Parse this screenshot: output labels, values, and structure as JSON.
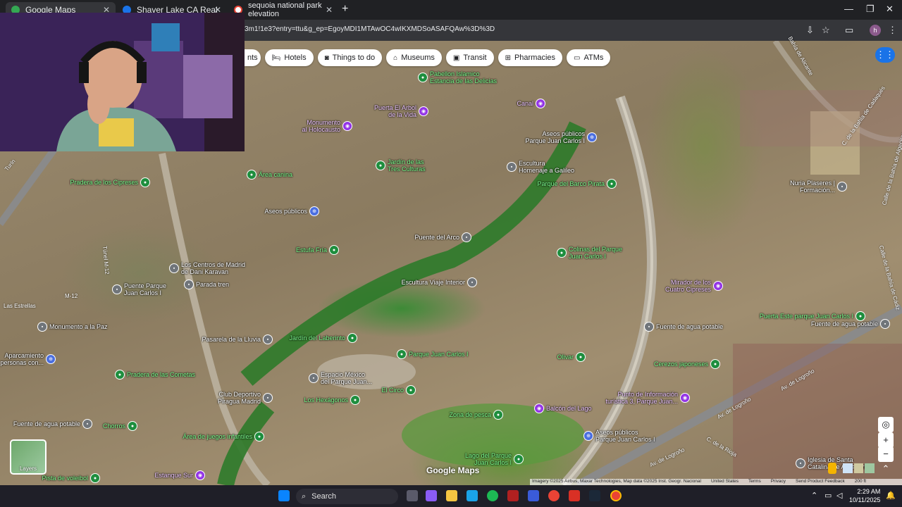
{
  "browser": {
    "tabs": [
      {
        "label": "Google Maps",
        "color": "#34a853"
      },
      {
        "label": "Shaver Lake CA Real Estate - Sh",
        "color": "#1a73e8"
      },
      {
        "label": "sequoia national park elevation",
        "color": "#ea4335"
      }
    ],
    "url": "3m1!1e3?entry=ttu&g_ep=EgoyMDI1MTAwOC4wIKXMDSoASAFQAw%3D%3D",
    "profile_initial": "h"
  },
  "map": {
    "chips": [
      {
        "label": "nts",
        "icon": ""
      },
      {
        "label": "Hotels",
        "icon": "bed-icon"
      },
      {
        "label": "Things to do",
        "icon": "camera-icon"
      },
      {
        "label": "Museums",
        "icon": "museum-icon"
      },
      {
        "label": "Transit",
        "icon": "train-icon"
      },
      {
        "label": "Pharmacies",
        "icon": "pharmacy-icon"
      },
      {
        "label": "ATMs",
        "icon": "atm-icon"
      }
    ],
    "pois": [
      {
        "label": "Pabellon Islamico\nEstancia de las Delicias",
        "type": "green"
      },
      {
        "label": "Puerta El Arbol\nde la Vida",
        "type": "purple"
      },
      {
        "label": "Monumento\nal Holocausto",
        "type": "purple"
      },
      {
        "label": "Canal",
        "type": "purple"
      },
      {
        "label": "Aseos públicos\nParque Juan Carlos I",
        "type": "blue"
      },
      {
        "label": "Jardín de las\nTres Culturas",
        "type": "green"
      },
      {
        "label": "Escultura\nHomenaje a Galileo",
        "type": "gray"
      },
      {
        "label": "Parque del Barco Pirata",
        "type": "green"
      },
      {
        "label": "Área canina",
        "type": "green"
      },
      {
        "label": "Pradera de los Cipreses",
        "type": "green"
      },
      {
        "label": "Aseos públicos",
        "type": "blue"
      },
      {
        "label": "Puente del Arco",
        "type": "gray"
      },
      {
        "label": "Estufa Fría",
        "type": "green"
      },
      {
        "label": "Colinas del Parque\nJuan Carlos I",
        "type": "green"
      },
      {
        "label": "Los Centros de Madrid\nde Dani Karavan",
        "type": "gray"
      },
      {
        "label": "Parada tren",
        "type": "gray"
      },
      {
        "label": "Puente Parque\nJuan Carlos I",
        "type": "gray"
      },
      {
        "label": "Escultura Viaje Interior",
        "type": "gray"
      },
      {
        "label": "Mirador de los\nCuatro Cipreses",
        "type": "purple"
      },
      {
        "label": "Fuente de agua potable",
        "type": "gray"
      },
      {
        "label": "Pasarela de la Lluvia",
        "type": "gray"
      },
      {
        "label": "Jardín del Laberinto",
        "type": "green"
      },
      {
        "label": "Parque Juan Carlos I",
        "type": "green"
      },
      {
        "label": "Olivar",
        "type": "green"
      },
      {
        "label": "Cerezos japoneses",
        "type": "green"
      },
      {
        "label": "Pradera de las Cometas",
        "type": "green"
      },
      {
        "label": "Espacio México\ndel Parque Juan...",
        "type": "gray"
      },
      {
        "label": "Club Deportivo\nPiragua Madrid",
        "type": "gray"
      },
      {
        "label": "El Circo",
        "type": "green"
      },
      {
        "label": "Los Hexágonos",
        "type": "green"
      },
      {
        "label": "Zona de pesca",
        "type": "green"
      },
      {
        "label": "Balcón del Lago",
        "type": "purple"
      },
      {
        "label": "Punto de Información\nturística 3, Parque Juan...",
        "type": "purple"
      },
      {
        "label": "Fuente de agua potable",
        "type": "gray"
      },
      {
        "label": "Chorros",
        "type": "green"
      },
      {
        "label": "Área de juegos infantiles",
        "type": "green"
      },
      {
        "label": "Aseos públicos\nParque Juan Carlos I",
        "type": "blue"
      },
      {
        "label": "Lago del Parque\nJuan Carlos I",
        "type": "green"
      },
      {
        "label": "Estanque Sur",
        "type": "purple"
      },
      {
        "label": "Pista de voleibol",
        "type": "green"
      },
      {
        "label": "Puerta Este parque Juan Carlos I",
        "type": "green"
      },
      {
        "label": "Nuria Plaseres |\nFormación...",
        "type": "gray"
      },
      {
        "label": "Monumento a la Paz",
        "type": "gray"
      },
      {
        "label": "Aparcamiento\npersonas con...",
        "type": "blue"
      },
      {
        "label": "Fuente de agua potable",
        "type": "gray"
      },
      {
        "label": "Iglesia de Santa\nCatalina de Alejandría",
        "type": "gray"
      }
    ],
    "streets": [
      "Turín",
      "Túnel M-12",
      "M-12",
      "Av. de Logroño",
      "Av. de Logroño",
      "C. de la Rioja",
      "Av. de Logroño",
      "Calle de la Bahía de Cádiz",
      "C. de la Bahía de Cadaqués",
      "Calle de la Bahía de Algeciras",
      "Las Estrellas",
      "Bahía de Alicante"
    ],
    "layers_label": "Layers",
    "brand": "Google Maps",
    "footer": [
      "Imagery ©2025 Airbus, Maxar Technologies, Map data ©2025 Inst. Geogr. Nacional",
      "United States",
      "Terms",
      "Privacy",
      "Send Product Feedback",
      "200 ft"
    ]
  },
  "taskbar": {
    "search_placeholder": "Search",
    "time": "2:29 AM",
    "date": "10/11/2025"
  }
}
